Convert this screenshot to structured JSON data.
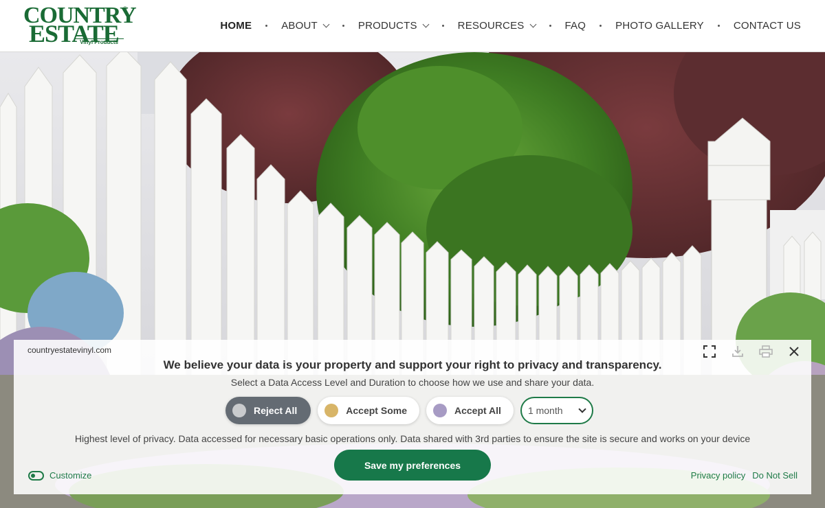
{
  "brand": {
    "line1": "COUNTRY",
    "line2": "ESTATE",
    "tagline": "Vinyl Products",
    "color": "#1a6b35"
  },
  "nav": [
    {
      "label": "HOME",
      "active": true,
      "dropdown": false
    },
    {
      "label": "ABOUT",
      "active": false,
      "dropdown": true
    },
    {
      "label": "PRODUCTS",
      "active": false,
      "dropdown": true
    },
    {
      "label": "RESOURCES",
      "active": false,
      "dropdown": true
    },
    {
      "label": "FAQ",
      "active": false,
      "dropdown": false
    },
    {
      "label": "PHOTO GALLERY",
      "active": false,
      "dropdown": false
    },
    {
      "label": "CONTACT US",
      "active": false,
      "dropdown": false
    }
  ],
  "consent": {
    "domain": "countryestatevinyl.com",
    "headline": "We believe your data is your property and support your right to privacy and transparency.",
    "subline": "Select a Data Access Level and Duration to choose how we use and share your data.",
    "levels": [
      {
        "label": "Reject All",
        "color": "#c9cbcd",
        "selected": true
      },
      {
        "label": "Accept Some",
        "color": "#d8b568",
        "selected": false
      },
      {
        "label": "Accept All",
        "color": "#a79bc4",
        "selected": false
      }
    ],
    "duration": "1 month",
    "description": "Highest level of privacy. Data accessed for necessary basic operations only. Data shared with 3rd parties to ensure the site is secure and works on your device",
    "save_label": "Save my preferences",
    "customize_label": "Customize",
    "privacy_link": "Privacy policy",
    "donotsell_link": "Do Not Sell",
    "accent": "#17784a"
  }
}
